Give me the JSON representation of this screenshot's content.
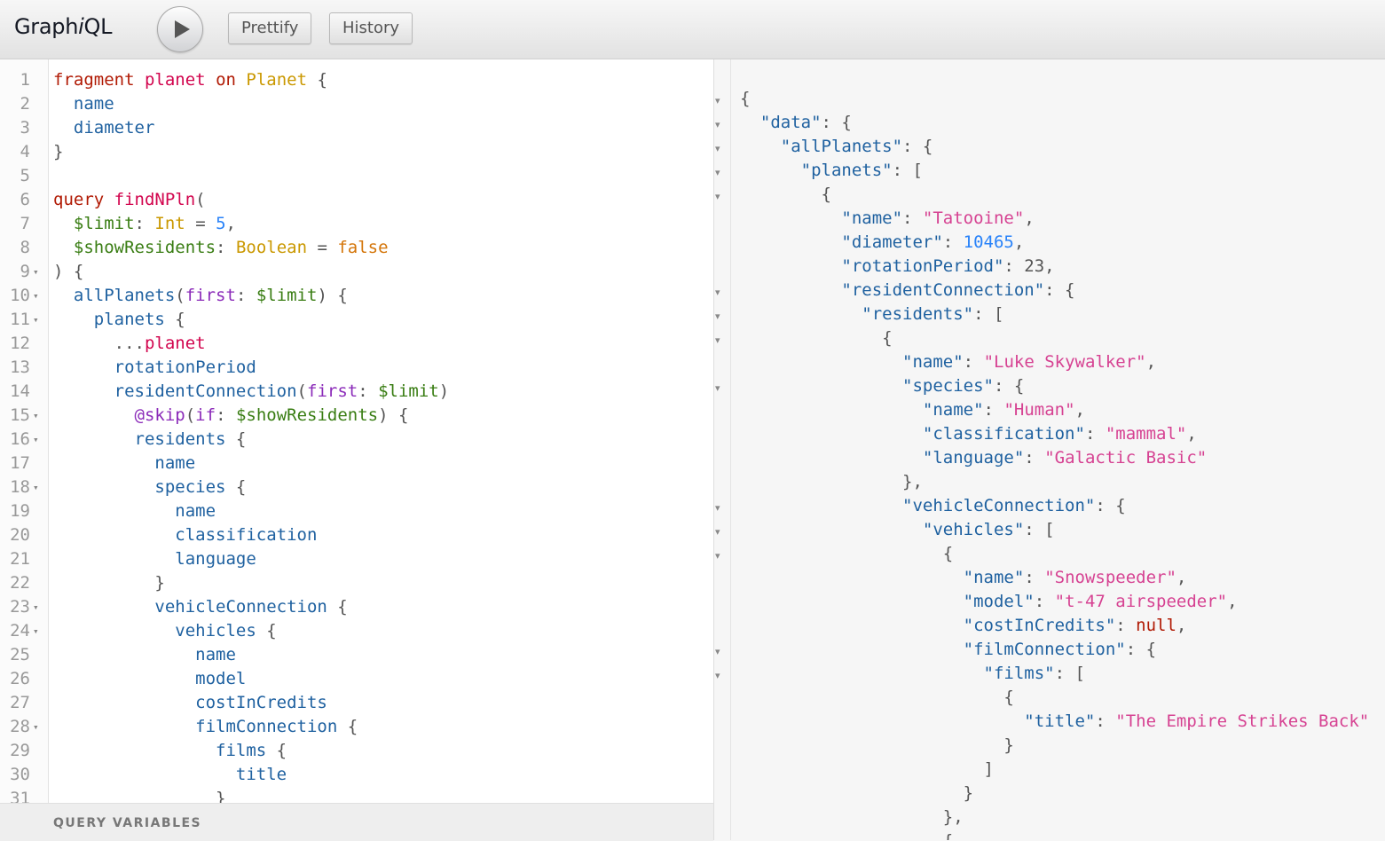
{
  "toolbar": {
    "logo_prefix": "Graph",
    "logo_italic": "i",
    "logo_suffix": "QL",
    "execute_icon": "play-icon",
    "prettify_label": "Prettify",
    "history_label": "History"
  },
  "editor": {
    "lines": [
      {
        "n": "1",
        "fold": false,
        "tokens": [
          [
            "kw",
            "fragment"
          ],
          [
            "punc",
            " "
          ],
          [
            "def",
            "planet"
          ],
          [
            "punc",
            " "
          ],
          [
            "kw",
            "on"
          ],
          [
            "punc",
            " "
          ],
          [
            "tn",
            "Planet"
          ],
          [
            "punc",
            " {"
          ]
        ]
      },
      {
        "n": "2",
        "fold": false,
        "tokens": [
          [
            "punc",
            "  "
          ],
          [
            "fld",
            "name"
          ]
        ]
      },
      {
        "n": "3",
        "fold": false,
        "tokens": [
          [
            "punc",
            "  "
          ],
          [
            "fld",
            "diameter"
          ]
        ]
      },
      {
        "n": "4",
        "fold": false,
        "tokens": [
          [
            "punc",
            "}"
          ]
        ]
      },
      {
        "n": "5",
        "fold": false,
        "tokens": []
      },
      {
        "n": "6",
        "fold": false,
        "tokens": [
          [
            "kw",
            "query"
          ],
          [
            "punc",
            " "
          ],
          [
            "def",
            "findNPln"
          ],
          [
            "punc",
            "("
          ]
        ]
      },
      {
        "n": "7",
        "fold": false,
        "tokens": [
          [
            "punc",
            "  "
          ],
          [
            "var",
            "$limit"
          ],
          [
            "punc",
            ": "
          ],
          [
            "tn",
            "Int"
          ],
          [
            "punc",
            " = "
          ],
          [
            "num",
            "5"
          ],
          [
            "punc",
            ","
          ]
        ]
      },
      {
        "n": "8",
        "fold": false,
        "tokens": [
          [
            "punc",
            "  "
          ],
          [
            "var",
            "$showResidents"
          ],
          [
            "punc",
            ": "
          ],
          [
            "tn",
            "Boolean"
          ],
          [
            "punc",
            " = "
          ],
          [
            "bool",
            "false"
          ]
        ]
      },
      {
        "n": "9",
        "fold": true,
        "tokens": [
          [
            "punc",
            ") {"
          ]
        ]
      },
      {
        "n": "10",
        "fold": true,
        "tokens": [
          [
            "punc",
            "  "
          ],
          [
            "fld",
            "allPlanets"
          ],
          [
            "punc",
            "("
          ],
          [
            "attr",
            "first"
          ],
          [
            "punc",
            ": "
          ],
          [
            "var",
            "$limit"
          ],
          [
            "punc",
            ") {"
          ]
        ]
      },
      {
        "n": "11",
        "fold": true,
        "tokens": [
          [
            "punc",
            "    "
          ],
          [
            "fld",
            "planets"
          ],
          [
            "punc",
            " {"
          ]
        ]
      },
      {
        "n": "12",
        "fold": false,
        "tokens": [
          [
            "punc",
            "      ..."
          ],
          [
            "def",
            "planet"
          ]
        ]
      },
      {
        "n": "13",
        "fold": false,
        "tokens": [
          [
            "punc",
            "      "
          ],
          [
            "fld",
            "rotationPeriod"
          ]
        ]
      },
      {
        "n": "14",
        "fold": false,
        "tokens": [
          [
            "punc",
            "      "
          ],
          [
            "fld",
            "residentConnection"
          ],
          [
            "punc",
            "("
          ],
          [
            "attr",
            "first"
          ],
          [
            "punc",
            ": "
          ],
          [
            "var",
            "$limit"
          ],
          [
            "punc",
            ")"
          ]
        ]
      },
      {
        "n": "15",
        "fold": true,
        "tokens": [
          [
            "punc",
            "        "
          ],
          [
            "attr",
            "@skip"
          ],
          [
            "punc",
            "("
          ],
          [
            "attr",
            "if"
          ],
          [
            "punc",
            ": "
          ],
          [
            "var",
            "$showResidents"
          ],
          [
            "punc",
            ") {"
          ]
        ]
      },
      {
        "n": "16",
        "fold": true,
        "tokens": [
          [
            "punc",
            "        "
          ],
          [
            "fld",
            "residents"
          ],
          [
            "punc",
            " {"
          ]
        ]
      },
      {
        "n": "17",
        "fold": false,
        "tokens": [
          [
            "punc",
            "          "
          ],
          [
            "fld",
            "name"
          ]
        ]
      },
      {
        "n": "18",
        "fold": true,
        "tokens": [
          [
            "punc",
            "          "
          ],
          [
            "fld",
            "species"
          ],
          [
            "punc",
            " {"
          ]
        ]
      },
      {
        "n": "19",
        "fold": false,
        "tokens": [
          [
            "punc",
            "            "
          ],
          [
            "fld",
            "name"
          ]
        ]
      },
      {
        "n": "20",
        "fold": false,
        "tokens": [
          [
            "punc",
            "            "
          ],
          [
            "fld",
            "classification"
          ]
        ]
      },
      {
        "n": "21",
        "fold": false,
        "tokens": [
          [
            "punc",
            "            "
          ],
          [
            "fld",
            "language"
          ]
        ]
      },
      {
        "n": "22",
        "fold": false,
        "tokens": [
          [
            "punc",
            "          }"
          ]
        ]
      },
      {
        "n": "23",
        "fold": true,
        "tokens": [
          [
            "punc",
            "          "
          ],
          [
            "fld",
            "vehicleConnection"
          ],
          [
            "punc",
            " {"
          ]
        ]
      },
      {
        "n": "24",
        "fold": true,
        "tokens": [
          [
            "punc",
            "            "
          ],
          [
            "fld",
            "vehicles"
          ],
          [
            "punc",
            " {"
          ]
        ]
      },
      {
        "n": "25",
        "fold": false,
        "tokens": [
          [
            "punc",
            "              "
          ],
          [
            "fld",
            "name"
          ]
        ]
      },
      {
        "n": "26",
        "fold": false,
        "tokens": [
          [
            "punc",
            "              "
          ],
          [
            "fld",
            "model"
          ]
        ]
      },
      {
        "n": "27",
        "fold": false,
        "tokens": [
          [
            "punc",
            "              "
          ],
          [
            "fld",
            "costInCredits"
          ]
        ]
      },
      {
        "n": "28",
        "fold": true,
        "tokens": [
          [
            "punc",
            "              "
          ],
          [
            "fld",
            "filmConnection"
          ],
          [
            "punc",
            " {"
          ]
        ]
      },
      {
        "n": "29",
        "fold": false,
        "tokens": [
          [
            "punc",
            "                "
          ],
          [
            "fld",
            "films"
          ],
          [
            "punc",
            " {"
          ]
        ]
      },
      {
        "n": "30",
        "fold": false,
        "tokens": [
          [
            "punc",
            "                  "
          ],
          [
            "fld",
            "title"
          ]
        ]
      },
      {
        "n": "31",
        "fold": false,
        "tokens": [
          [
            "punc",
            "                }"
          ]
        ]
      }
    ]
  },
  "variables_panel": {
    "title": "QUERY VARIABLES"
  },
  "result": {
    "lines": [
      {
        "fold": true,
        "tokens": [
          [
            "p",
            "{"
          ]
        ]
      },
      {
        "fold": true,
        "tokens": [
          [
            "p",
            "  "
          ],
          [
            "k",
            "\"data\""
          ],
          [
            "p",
            ": {"
          ]
        ]
      },
      {
        "fold": true,
        "tokens": [
          [
            "p",
            "    "
          ],
          [
            "k",
            "\"allPlanets\""
          ],
          [
            "p",
            ": {"
          ]
        ]
      },
      {
        "fold": true,
        "tokens": [
          [
            "p",
            "      "
          ],
          [
            "k",
            "\"planets\""
          ],
          [
            "p",
            ": ["
          ]
        ]
      },
      {
        "fold": true,
        "tokens": [
          [
            "p",
            "        {"
          ]
        ]
      },
      {
        "fold": false,
        "tokens": [
          [
            "p",
            "          "
          ],
          [
            "k",
            "\"name\""
          ],
          [
            "p",
            ": "
          ],
          [
            "s",
            "\"Tatooine\""
          ],
          [
            "p",
            ","
          ]
        ]
      },
      {
        "fold": false,
        "tokens": [
          [
            "p",
            "          "
          ],
          [
            "k",
            "\"diameter\""
          ],
          [
            "p",
            ": "
          ],
          [
            "n",
            "10465"
          ],
          [
            "p",
            ","
          ]
        ]
      },
      {
        "fold": false,
        "tokens": [
          [
            "p",
            "          "
          ],
          [
            "k",
            "\"rotationPeriod\""
          ],
          [
            "p",
            ": 23,"
          ]
        ]
      },
      {
        "fold": true,
        "tokens": [
          [
            "p",
            "          "
          ],
          [
            "k",
            "\"residentConnection\""
          ],
          [
            "p",
            ": {"
          ]
        ]
      },
      {
        "fold": true,
        "tokens": [
          [
            "p",
            "            "
          ],
          [
            "k",
            "\"residents\""
          ],
          [
            "p",
            ": ["
          ]
        ]
      },
      {
        "fold": true,
        "tokens": [
          [
            "p",
            "              {"
          ]
        ]
      },
      {
        "fold": false,
        "tokens": [
          [
            "p",
            "                "
          ],
          [
            "k",
            "\"name\""
          ],
          [
            "p",
            ": "
          ],
          [
            "s",
            "\"Luke Skywalker\""
          ],
          [
            "p",
            ","
          ]
        ]
      },
      {
        "fold": true,
        "tokens": [
          [
            "p",
            "                "
          ],
          [
            "k",
            "\"species\""
          ],
          [
            "p",
            ": {"
          ]
        ]
      },
      {
        "fold": false,
        "tokens": [
          [
            "p",
            "                  "
          ],
          [
            "k",
            "\"name\""
          ],
          [
            "p",
            ": "
          ],
          [
            "s",
            "\"Human\""
          ],
          [
            "p",
            ","
          ]
        ]
      },
      {
        "fold": false,
        "tokens": [
          [
            "p",
            "                  "
          ],
          [
            "k",
            "\"classification\""
          ],
          [
            "p",
            ": "
          ],
          [
            "s",
            "\"mammal\""
          ],
          [
            "p",
            ","
          ]
        ]
      },
      {
        "fold": false,
        "tokens": [
          [
            "p",
            "                  "
          ],
          [
            "k",
            "\"language\""
          ],
          [
            "p",
            ": "
          ],
          [
            "s",
            "\"Galactic Basic\""
          ]
        ]
      },
      {
        "fold": false,
        "tokens": [
          [
            "p",
            "                },"
          ]
        ]
      },
      {
        "fold": true,
        "tokens": [
          [
            "p",
            "                "
          ],
          [
            "k",
            "\"vehicleConnection\""
          ],
          [
            "p",
            ": {"
          ]
        ]
      },
      {
        "fold": true,
        "tokens": [
          [
            "p",
            "                  "
          ],
          [
            "k",
            "\"vehicles\""
          ],
          [
            "p",
            ": ["
          ]
        ]
      },
      {
        "fold": true,
        "tokens": [
          [
            "p",
            "                    {"
          ]
        ]
      },
      {
        "fold": false,
        "tokens": [
          [
            "p",
            "                      "
          ],
          [
            "k",
            "\"name\""
          ],
          [
            "p",
            ": "
          ],
          [
            "s",
            "\"Snowspeeder\""
          ],
          [
            "p",
            ","
          ]
        ]
      },
      {
        "fold": false,
        "tokens": [
          [
            "p",
            "                      "
          ],
          [
            "k",
            "\"model\""
          ],
          [
            "p",
            ": "
          ],
          [
            "s",
            "\"t-47 airspeeder\""
          ],
          [
            "p",
            ","
          ]
        ]
      },
      {
        "fold": false,
        "tokens": [
          [
            "p",
            "                      "
          ],
          [
            "k",
            "\"costInCredits\""
          ],
          [
            "p",
            ": "
          ],
          [
            "x",
            "null"
          ],
          [
            "p",
            ","
          ]
        ]
      },
      {
        "fold": true,
        "tokens": [
          [
            "p",
            "                      "
          ],
          [
            "k",
            "\"filmConnection\""
          ],
          [
            "p",
            ": {"
          ]
        ]
      },
      {
        "fold": true,
        "tokens": [
          [
            "p",
            "                        "
          ],
          [
            "k",
            "\"films\""
          ],
          [
            "p",
            ": ["
          ]
        ]
      },
      {
        "fold": false,
        "tokens": [
          [
            "p",
            "                          {"
          ]
        ]
      },
      {
        "fold": false,
        "tokens": [
          [
            "p",
            "                            "
          ],
          [
            "k",
            "\"title\""
          ],
          [
            "p",
            ": "
          ],
          [
            "s",
            "\"The Empire Strikes Back\""
          ]
        ]
      },
      {
        "fold": false,
        "tokens": [
          [
            "p",
            "                          }"
          ]
        ]
      },
      {
        "fold": false,
        "tokens": [
          [
            "p",
            "                        ]"
          ]
        ]
      },
      {
        "fold": false,
        "tokens": [
          [
            "p",
            "                      }"
          ]
        ]
      },
      {
        "fold": false,
        "tokens": [
          [
            "p",
            "                    },"
          ]
        ]
      },
      {
        "fold": false,
        "tokens": [
          [
            "p",
            "                    {"
          ]
        ]
      }
    ]
  }
}
